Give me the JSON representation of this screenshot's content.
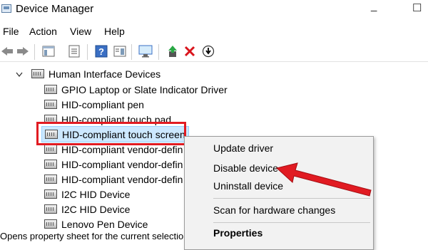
{
  "window": {
    "title": "Device Manager",
    "minimize": "_",
    "close": "☐"
  },
  "menu": [
    "File",
    "Action",
    "View",
    "Help"
  ],
  "toolbar": [
    "back-icon",
    "forward-icon",
    "show-hide-tree-icon",
    "properties-icon",
    "help-icon",
    "action-pane-icon",
    "monitor-icon",
    "update-driver-icon",
    "uninstall-icon",
    "disable-icon"
  ],
  "tree": {
    "category": "Human Interface Devices",
    "items": [
      "GPIO Laptop or Slate Indicator Driver",
      "HID-compliant pen",
      "HID-compliant touch pad",
      "HID-compliant touch screen",
      "HID-compliant vendor-defin",
      "HID-compliant vendor-defin",
      "HID-compliant vendor-defin",
      "I2C HID Device",
      "I2C HID Device",
      "Lenovo Pen Device"
    ]
  },
  "context_menu": {
    "items": [
      "Update driver",
      "Disable device",
      "Uninstall device",
      "Scan for hardware changes",
      "Properties"
    ]
  },
  "status_bar": "Opens property sheet for the current selectio",
  "colors": {
    "highlight": "#e11b22",
    "arrow": "#e11b22",
    "selection": "#cce8ff"
  }
}
